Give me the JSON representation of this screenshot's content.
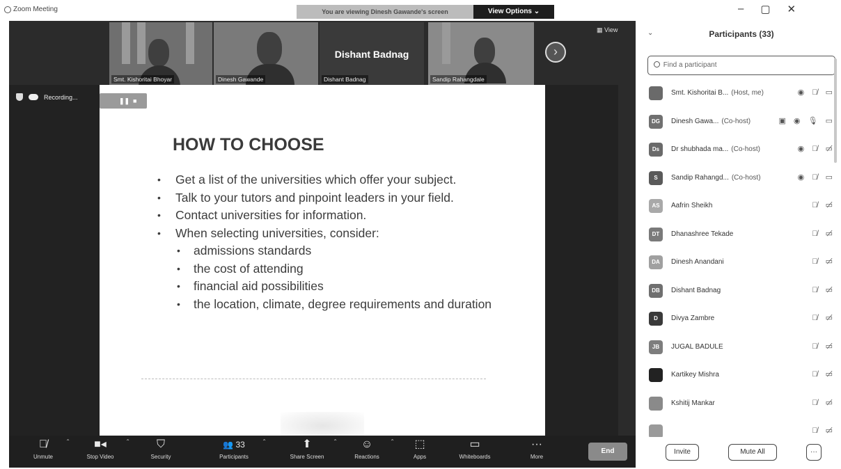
{
  "window": {
    "title": "Zoom Meeting",
    "viewing_banner": "You are viewing Dinesh Gawande's screen",
    "view_options": "View Options ⌄",
    "controls": [
      "–",
      "▢",
      "✕"
    ]
  },
  "gallery": {
    "view_label": "▦ View",
    "thumbs": [
      {
        "name": "Smt. Kishoritai Bhoyar"
      },
      {
        "name": "Dinesh Gawande"
      },
      {
        "name": "Dishant Badnag",
        "speaker": "Dishant Badnag"
      },
      {
        "name": "Sandip Rahangdale"
      }
    ]
  },
  "recording": {
    "label": "Recording...",
    "pause": "❚❚",
    "stop": "■"
  },
  "slide": {
    "title": "HOW TO CHOOSE",
    "bullets": [
      "Get a list of the universities which offer your subject.",
      "Talk to your tutors and pinpoint leaders in your field.",
      "Contact universities for information.",
      "When selecting universities, consider:"
    ],
    "sub_bullets": [
      "admissions standards",
      "the cost of attending",
      "financial aid possibilities",
      "the location, climate, degree requirements and duration"
    ]
  },
  "toolbar": {
    "unmute": "Unmute",
    "stop_video": "Stop Video",
    "security": "Security",
    "participants": "Participants",
    "participants_count": "33",
    "share_screen": "Share Screen",
    "reactions": "Reactions",
    "apps": "Apps",
    "whiteboards": "Whiteboards",
    "more": "More",
    "end": "End"
  },
  "panel": {
    "title": "Participants (33)",
    "search_placeholder": "Find a participant",
    "participants": [
      {
        "initials": "",
        "name": "Smt. Kishoritai B...",
        "role": "(Host, me)",
        "icons": "◉ 🎙̸ ▭",
        "color": "#6a6a6a"
      },
      {
        "initials": "DG",
        "name": "Dinesh Gawa...",
        "role": "(Co-host)",
        "icons": "▣ ◉ 🎙 ▭",
        "color": "#707070"
      },
      {
        "initials": "Ds",
        "name": "Dr shubhada ma...",
        "role": "(Co-host)",
        "icons": "◉ 🎙̸ ▭̸",
        "color": "#6a6a6a"
      },
      {
        "initials": "S",
        "name": "Sandip Rahangd...",
        "role": "(Co-host)",
        "icons": "◉ 🎙̸ ▭",
        "color": "#5a5a5a"
      },
      {
        "initials": "AS",
        "name": "Aafrin Sheikh",
        "role": "",
        "icons": "🎙̸ ▭̸",
        "color": "#a9a9a9"
      },
      {
        "initials": "DT",
        "name": "Dhanashree Tekade",
        "role": "",
        "icons": "🎙̸ ▭̸",
        "color": "#7a7a7a"
      },
      {
        "initials": "DA",
        "name": "Dinesh Anandani",
        "role": "",
        "icons": "🎙̸ ▭̸",
        "color": "#a0a0a0"
      },
      {
        "initials": "DB",
        "name": "Dishant Badnag",
        "role": "",
        "icons": "🎙̸ ▭̸",
        "color": "#6f6f6f"
      },
      {
        "initials": "D",
        "name": "Divya Zambre",
        "role": "",
        "icons": "🎙̸ ▭̸",
        "color": "#3a3a3a"
      },
      {
        "initials": "JB",
        "name": "JUGAL BADULE",
        "role": "",
        "icons": "🎙̸ ▭̸",
        "color": "#7d7d7d"
      },
      {
        "initials": "",
        "name": "Kartikey Mishra",
        "role": "",
        "icons": "🎙̸ ▭̸",
        "color": "#222222"
      },
      {
        "initials": "",
        "name": "Kshitij Mankar",
        "role": "",
        "icons": "🎙̸ ▭̸",
        "color": "#8a8a8a"
      },
      {
        "initials": "",
        "name": "",
        "role": "",
        "icons": "🎙̸ ▭̸",
        "color": "#9a9a9a"
      }
    ],
    "invite": "Invite",
    "mute_all": "Mute All",
    "more": "···"
  }
}
